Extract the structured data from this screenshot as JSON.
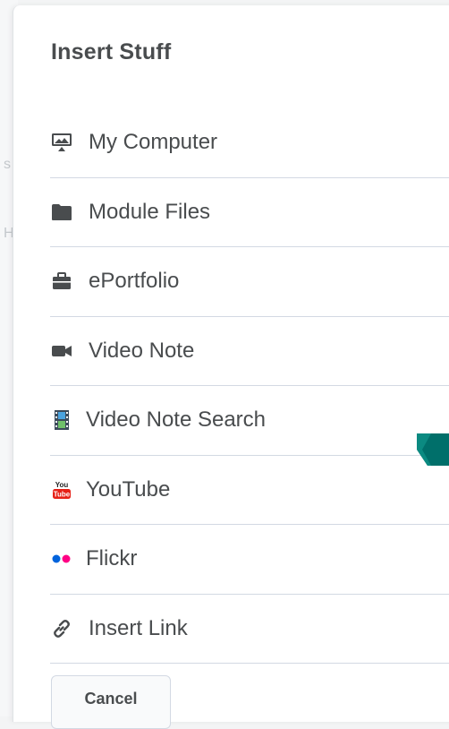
{
  "dialog": {
    "title": "Insert Stuff",
    "cancel_label": "Cancel"
  },
  "menu": {
    "items": [
      {
        "label": "My Computer",
        "icon": "desktop-upload-icon"
      },
      {
        "label": "Module Files",
        "icon": "folder-icon"
      },
      {
        "label": "ePortfolio",
        "icon": "briefcase-icon"
      },
      {
        "label": "Video Note",
        "icon": "video-camera-icon"
      },
      {
        "label": "Video Note Search",
        "icon": "film-strip-icon"
      },
      {
        "label": "YouTube",
        "icon": "youtube-logo-icon"
      },
      {
        "label": "Flickr",
        "icon": "flickr-logo-icon"
      },
      {
        "label": "Insert Link",
        "icon": "link-icon"
      }
    ]
  },
  "background": {
    "ghost_letters": [
      "s",
      "H"
    ]
  },
  "colors": {
    "text": "#494c4e",
    "divider": "#d3d9e3",
    "accent_tab": "#006f6a",
    "youtube_red": "#e62117",
    "flickr_blue": "#0063dc",
    "flickr_pink": "#ff0084"
  }
}
